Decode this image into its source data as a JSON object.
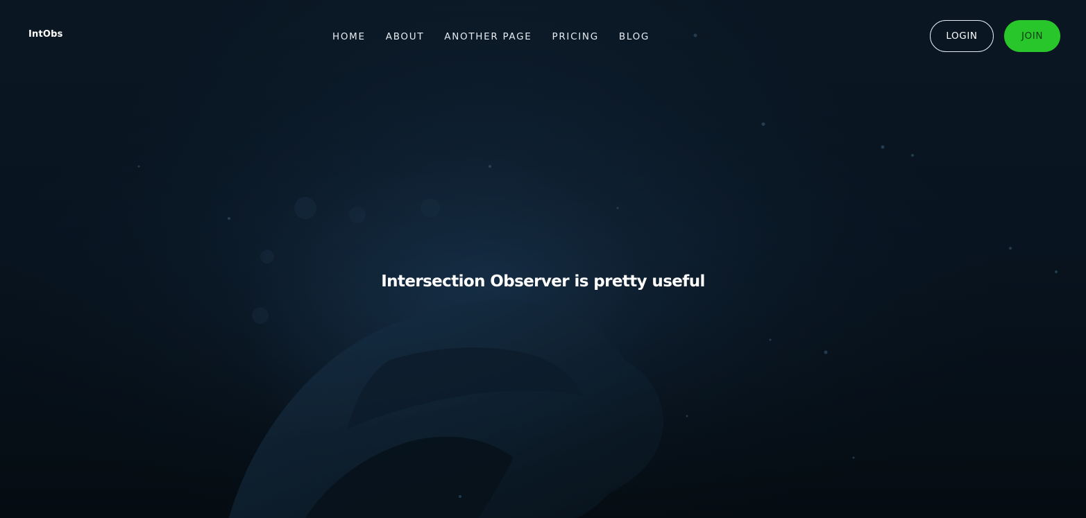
{
  "brand": {
    "logo_text": "IntObs"
  },
  "nav": {
    "links": [
      {
        "label": "HOME"
      },
      {
        "label": "ABOUT"
      },
      {
        "label": "ANOTHER PAGE"
      },
      {
        "label": "PRICING"
      },
      {
        "label": "BLOG"
      }
    ],
    "login_label": "LOGIN",
    "join_label": "JOIN"
  },
  "hero": {
    "headline": "Intersection Observer is pretty useful",
    "background_image": "underwater-swimmer-photo"
  },
  "colors": {
    "background": "#061018",
    "text": "#ffffff",
    "accent_join": "#28c62b"
  }
}
